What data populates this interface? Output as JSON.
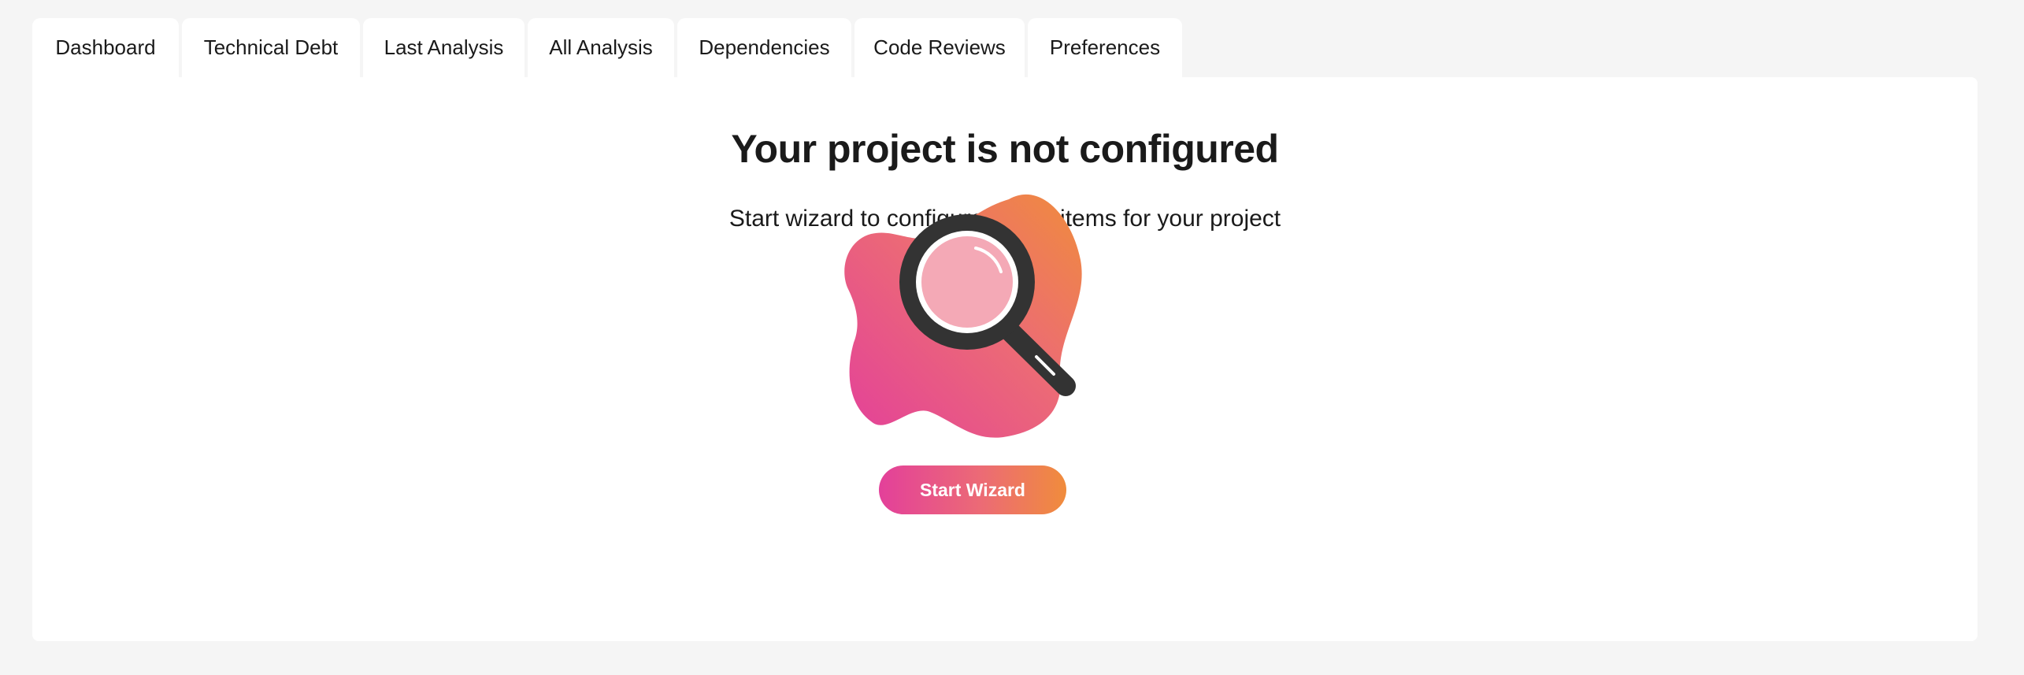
{
  "tabs": [
    {
      "label": "Dashboard"
    },
    {
      "label": "Technical Debt"
    },
    {
      "label": "Last Analysis"
    },
    {
      "label": "All Analysis"
    },
    {
      "label": "Dependencies"
    },
    {
      "label": "Code Reviews"
    },
    {
      "label": "Preferences"
    }
  ],
  "main": {
    "title": "Your project is not configured",
    "subtitle": "Start wizard to configure all the items for your project",
    "illustration_icon": "magnifying-glass-icon",
    "wizard_button_label": "Start Wizard"
  },
  "colors": {
    "page_background": "#f5f5f5",
    "panel_background": "#ffffff",
    "gradient_start": "#e3409a",
    "gradient_end": "#f08c3c",
    "magnifier_dark": "#333333",
    "lens_pink": "#f4a9b6"
  }
}
